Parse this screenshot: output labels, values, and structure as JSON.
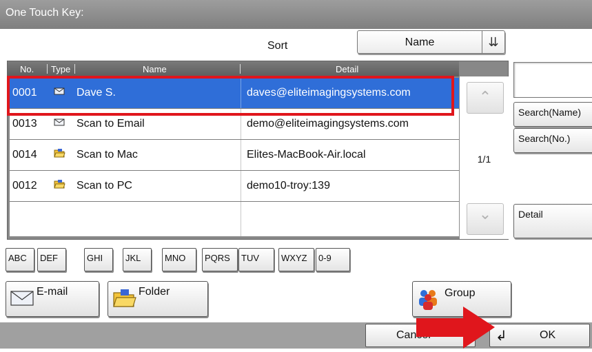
{
  "window": {
    "title": "One Touch Key:"
  },
  "sort": {
    "label": "Sort",
    "value": "Name"
  },
  "list": {
    "columns": {
      "no": "No.",
      "type": "Type",
      "name": "Name",
      "detail": "Detail"
    },
    "rows": [
      {
        "no": "0001",
        "type_icon": "envelope-icon",
        "name": "Dave S.",
        "detail": "daves@eliteimagingsystems.com",
        "selected": true
      },
      {
        "no": "0013",
        "type_icon": "envelope-icon",
        "name": "Scan to Email",
        "detail": "demo@eliteimagingsystems.com",
        "selected": false
      },
      {
        "no": "0014",
        "type_icon": "folder-icon",
        "name": "Scan to Mac",
        "detail": "Elites-MacBook-Air.local",
        "selected": false
      },
      {
        "no": "0012",
        "type_icon": "folder-icon",
        "name": "Scan to PC",
        "detail": "demo10-troy:139",
        "selected": false
      }
    ],
    "page": "1/1"
  },
  "side": {
    "search_name": "Search(Name)",
    "search_no": "Search(No.)",
    "detail": "Detail"
  },
  "index_keys": [
    "ABC",
    "DEF",
    "GHI",
    "JKL",
    "MNO",
    "PQRS",
    "TUV",
    "WXYZ",
    "0-9"
  ],
  "filters": {
    "email": "E-mail",
    "folder": "Folder",
    "group": "Group"
  },
  "footer": {
    "cancel": "Cancel",
    "ok": "OK"
  },
  "colors": {
    "selection": "#2f6ed8",
    "highlight_box": "#e0161c",
    "arrow": "#e0161c"
  }
}
